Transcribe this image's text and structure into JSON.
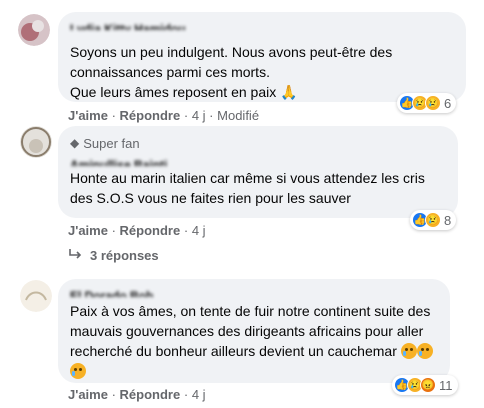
{
  "comments": [
    {
      "author": "Lydia Kitty Hamidou",
      "text": "Soyons un peu indulgent. Nous avons peut-être des connaissances parmi ces morts.\nQue leurs âmes reposent en paix",
      "emoji": "🙏",
      "like_label": "J'aime",
      "reply_label": "Répondre",
      "time": "4 j",
      "edited": "Modifié",
      "reaction_count": "6"
    },
    {
      "badge": "Super fan",
      "author": "Aminullise Bainti",
      "text": "Honte au marin italien car même si vous attendez les cris des S.O.S vous ne faites rien pour les sauver",
      "like_label": "J'aime",
      "reply_label": "Répondre",
      "time": "4 j",
      "reaction_count": "8",
      "replies_label": "3 réponses"
    },
    {
      "author": "El Dorado Bob",
      "text": "Paix à vos âmes, on tente de fuir notre continent suite des mauvais gouvernances des dirigeants africains pour aller recherché du bonheur ailleurs devient un cauchemar",
      "like_label": "J'aime",
      "reply_label": "Répondre",
      "time": "4 j",
      "reaction_count": "11"
    }
  ],
  "separator": "·",
  "icons": {
    "like": "like-reaction-icon",
    "sad": "sad-reaction-icon",
    "angry": "angry-reaction-icon",
    "badge": "diamond-icon",
    "reply_arrow": "reply-arrow-icon"
  },
  "colors": {
    "like": "#1877f2",
    "sad": "#f7b125",
    "angry": "#e9710f",
    "bubble": "#f0f2f5",
    "meta": "#65676b"
  }
}
